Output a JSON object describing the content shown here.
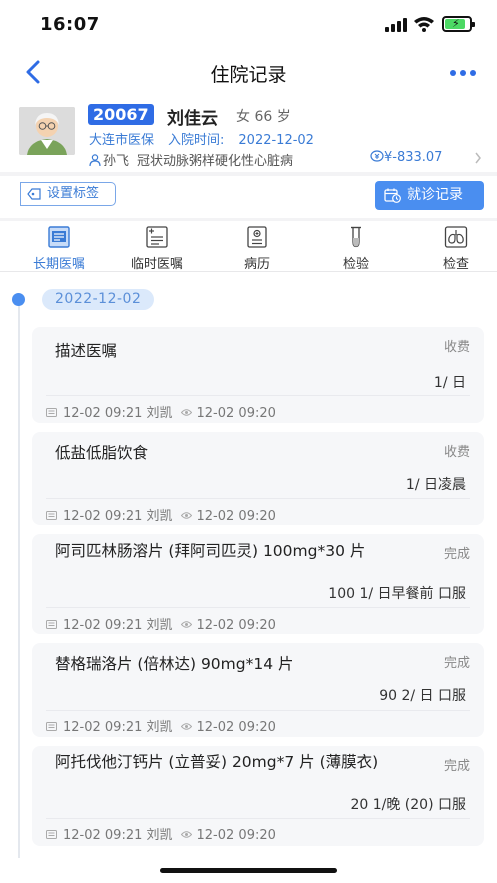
{
  "status_bar": {
    "time": "16:07"
  },
  "nav": {
    "title": "住院记录"
  },
  "patient": {
    "bed_no": "20067",
    "name": "刘佳云",
    "gender_age": "女 66 岁",
    "insurance": "大连市医保",
    "admission_label": "入院时间:",
    "admission_date": "2022-12-02",
    "doctor": "孙飞",
    "diagnosis": "冠状动脉粥样硬化性心脏病",
    "fee": "¥-833.07"
  },
  "actions": {
    "tag_label": "设置标签",
    "visit_label": "就诊记录"
  },
  "tabs": [
    {
      "label": "长期医嘱",
      "icon": "long-term-order-icon",
      "active": true
    },
    {
      "label": "临时医嘱",
      "icon": "temporary-order-icon",
      "active": false
    },
    {
      "label": "病历",
      "icon": "medical-record-icon",
      "active": false
    },
    {
      "label": "检验",
      "icon": "test-tube-icon",
      "active": false
    },
    {
      "label": "检查",
      "icon": "lung-scan-icon",
      "active": false
    }
  ],
  "timeline": {
    "date": "2022-12-02"
  },
  "orders": [
    {
      "title": "描述医嘱",
      "status": "收费",
      "dose": "1/ 日",
      "created": "12-02 09:21 刘凯",
      "reviewed": "12-02 09:20"
    },
    {
      "title": "低盐低脂饮食",
      "status": "收费",
      "dose": "1/ 日凌晨",
      "created": "12-02 09:21 刘凯",
      "reviewed": "12-02 09:20"
    },
    {
      "title": "阿司匹林肠溶片 (拜阿司匹灵) 100mg*30 片",
      "status": "完成",
      "dose": "100 1/ 日早餐前 口服",
      "created": "12-02 09:21 刘凯",
      "reviewed": "12-02 09:20"
    },
    {
      "title": "替格瑞洛片 (倍林达) 90mg*14 片",
      "status": "完成",
      "dose": "90 2/ 日 口服",
      "created": "12-02 09:21 刘凯",
      "reviewed": "12-02 09:20"
    },
    {
      "title": "阿托伐他汀钙片 (立普妥) 20mg*7 片 (薄膜衣)",
      "status": "完成",
      "dose": "20 1/晚 (20) 口服",
      "created": "12-02 09:21 刘凯",
      "reviewed": "12-02 09:20"
    }
  ],
  "colors": {
    "accent": "#2f6ce5",
    "button": "#4a8ef0",
    "card_bg": "#f6f7f9"
  }
}
